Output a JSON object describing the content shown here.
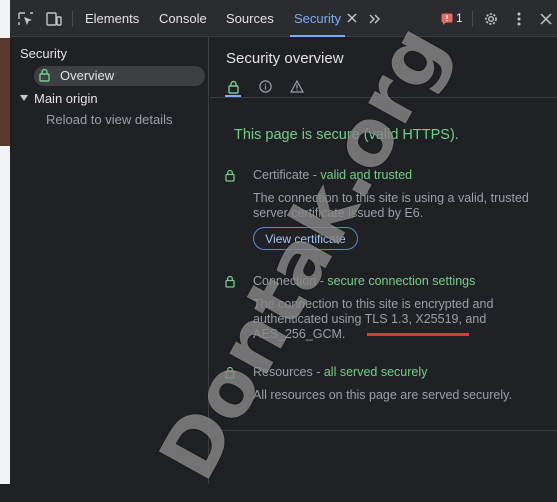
{
  "toolbar": {
    "tabs": [
      {
        "label": "Elements"
      },
      {
        "label": "Console"
      },
      {
        "label": "Sources"
      },
      {
        "label": "Security"
      }
    ],
    "issues_count": "1"
  },
  "sidebar": {
    "section_title": "Security",
    "overview_label": "Overview",
    "main_origin_label": "Main origin",
    "reload_hint": "Reload to view details"
  },
  "main": {
    "title": "Security overview",
    "secure_heading": "This page is secure (valid HTTPS).",
    "certificate": {
      "label": "Certificate",
      "sep": " - ",
      "status": "valid and trusted",
      "description": "The connection to this site is using a valid, trusted server certificate issued by E6.",
      "button_label": "View certificate"
    },
    "connection": {
      "label": "Connection",
      "sep": " - ",
      "status": "secure connection settings",
      "description": "The connection to this site is encrypted and authenticated using TLS 1.3, X25519, and AES_256_GCM."
    },
    "resources": {
      "label": "Resources",
      "sep": " - ",
      "status": "all served securely",
      "description": "All resources on this page are served securely."
    }
  },
  "watermark": {
    "text": "Dontak.org"
  },
  "colors": {
    "accent": "#7cacf8",
    "secure_green": "#72d08b",
    "highlight_red": "#e53935"
  }
}
